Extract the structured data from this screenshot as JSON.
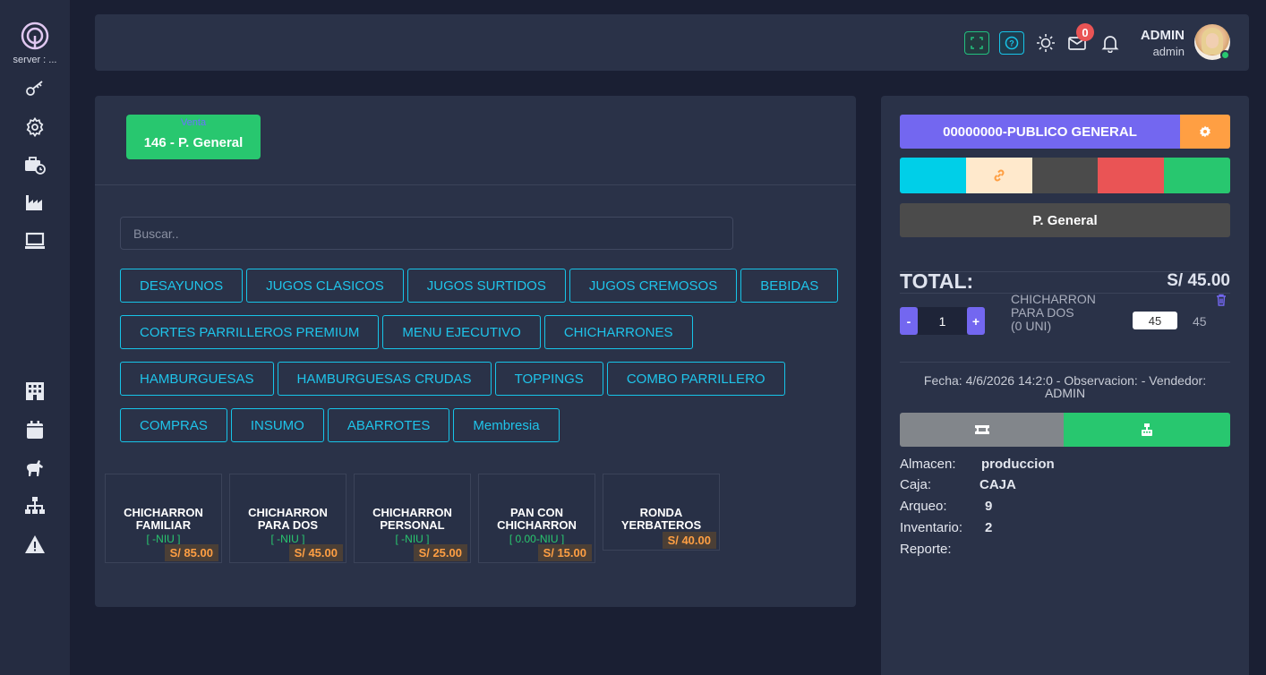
{
  "sidebar": {
    "server_label": "server : ...",
    "icons": [
      "key-icon",
      "gear-icon",
      "briefcase-clock-icon",
      "industry-icon",
      "laptop-icon",
      "building-icon",
      "calendar-icon",
      "horse-icon",
      "sitemap-icon",
      "warning-icon"
    ]
  },
  "header": {
    "notification_count": "0",
    "user_name": "ADMIN",
    "user_role": "admin"
  },
  "main": {
    "venta_label": "Venta",
    "venta_button": "146 - P. General",
    "search_placeholder": "Buscar..",
    "categories": [
      [
        "DESAYUNOS",
        "JUGOS CLASICOS",
        "JUGOS SURTIDOS",
        "JUGOS CREMOSOS",
        "BEBIDAS"
      ],
      [
        "CORTES PARRILLEROS PREMIUM",
        "MENU EJECUTIVO",
        "CHICHARRONES"
      ],
      [
        "HAMBURGUESAS",
        "HAMBURGUESAS CRUDAS",
        "TOPPINGS",
        "COMBO PARRILLERO"
      ],
      [
        "COMPRAS",
        "INSUMO",
        "ABARROTES",
        "Membresia"
      ]
    ],
    "products": [
      {
        "line1": "CHICHARRON",
        "line2": "FAMILIAR",
        "code": "[ -NIU ]",
        "price": "S/ 85.00"
      },
      {
        "line1": "CHICHARRON",
        "line2": "PARA DOS",
        "code": "[ -NIU ]",
        "price": "S/ 45.00"
      },
      {
        "line1": "CHICHARRON",
        "line2": "PERSONAL",
        "code": "[ -NIU ]",
        "price": "S/ 25.00"
      },
      {
        "line1": "PAN CON",
        "line2": "CHICHARRON",
        "code": "[ 0.00-NIU ]",
        "price": "S/ 15.00"
      },
      {
        "line1": "RONDA",
        "line2": "YERBATEROS",
        "code": "",
        "price": "S/ 40.00"
      }
    ]
  },
  "cart": {
    "client": "00000000-PUBLICO GENERAL",
    "colors": [
      "#00cfe8",
      "#ffe9cc",
      "#4b4b4b",
      "#ea5455",
      "#28c76f"
    ],
    "client_type": "P. General",
    "total_label": "TOTAL:",
    "total_value": "S/ 45.00",
    "item": {
      "qty": "1",
      "name_line1": "CHICHARRON",
      "name_line2": "PARA DOS",
      "name_line3": "(0 UNI)",
      "price": "45",
      "subtotal": "45"
    },
    "meta_line1": "Fecha: 4/6/2026 14:2:0 - Observacion: - Vendedor:",
    "meta_line2": "ADMIN",
    "info": [
      {
        "label": "Almacen:",
        "value": "produccion"
      },
      {
        "label": "Caja:",
        "value": "CAJA"
      },
      {
        "label": "Arqueo:",
        "value": "9"
      },
      {
        "label": "Inventario:",
        "value": "2"
      },
      {
        "label": "Reporte:",
        "value": ""
      }
    ]
  }
}
